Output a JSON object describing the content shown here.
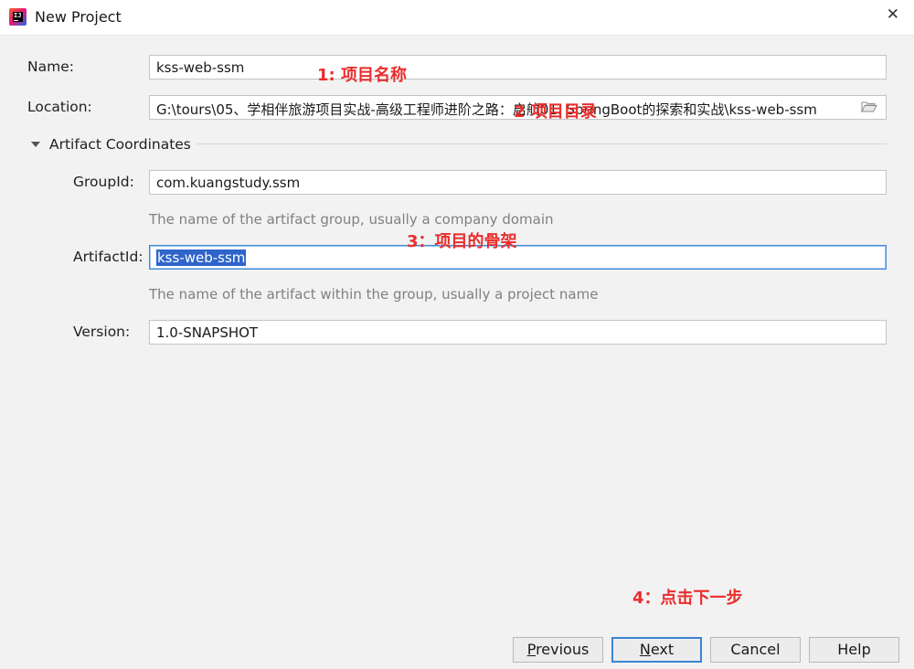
{
  "window": {
    "title": "New Project"
  },
  "form": {
    "name_label": "Name:",
    "name_value": "kss-web-ssm",
    "location_label": "Location:",
    "location_value": "G:\\tours\\05、学相伴旅游项目实战-高级工程师进阶之路：启航01. SpringBoot的探索和实战\\kss-web-ssm",
    "section_title": "Artifact Coordinates",
    "groupid_label": "GroupId:",
    "groupid_value": "com.kuangstudy.ssm",
    "groupid_hint": "The name of the artifact group, usually a company domain",
    "artifactid_label": "ArtifactId:",
    "artifactid_value": "kss-web-ssm",
    "artifactid_hint": "The name of the artifact within the group, usually a project name",
    "version_label": "Version:",
    "version_value": "1.0-SNAPSHOT"
  },
  "annotations": {
    "a1": "1: 项目名称",
    "a2": "2 项目目录",
    "a3": "3：项目的骨架",
    "a4": "4：点击下一步"
  },
  "buttons": {
    "previous_mn": "P",
    "previous_rest": "revious",
    "next_mn": "N",
    "next_rest": "ext",
    "cancel": "Cancel",
    "help": "Help"
  },
  "colors": {
    "accent": "#3b84d4",
    "annotation": "#ea2d2d",
    "selection": "#2f65ca"
  },
  "icons": [
    "intellij-app-icon",
    "close-icon",
    "folder-icon",
    "triangle-down-icon"
  ]
}
